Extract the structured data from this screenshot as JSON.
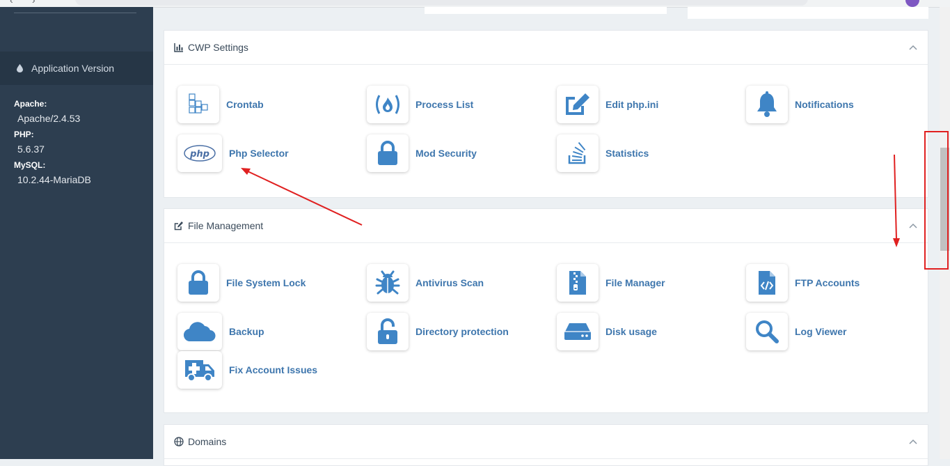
{
  "sidebar": {
    "app_version_label": "Application Version",
    "versions": [
      {
        "key": "Apache:",
        "value": "Apache/2.4.53"
      },
      {
        "key": "PHP:",
        "value": "5.6.37"
      },
      {
        "key": "MySQL:",
        "value": "10.2.44-MariaDB"
      }
    ]
  },
  "cwp_settings": {
    "title": "CWP Settings",
    "items": [
      {
        "label": "Crontab",
        "icon": "crontab-icon"
      },
      {
        "label": "Process List",
        "icon": "process-list-icon"
      },
      {
        "label": "Edit php.ini",
        "icon": "edit-icon"
      },
      {
        "label": "Notifications",
        "icon": "bell-icon"
      },
      {
        "label": "Php Selector",
        "icon": "php-icon"
      },
      {
        "label": "Mod Security",
        "icon": "lock-icon"
      },
      {
        "label": "Statistics",
        "icon": "stack-icon"
      }
    ]
  },
  "file_management": {
    "title": "File Management",
    "items": [
      {
        "label": "File System Lock",
        "icon": "lock-icon"
      },
      {
        "label": "Antivirus Scan",
        "icon": "bug-icon"
      },
      {
        "label": "File Manager",
        "icon": "file-archive-icon"
      },
      {
        "label": "FTP Accounts",
        "icon": "file-code-icon"
      },
      {
        "label": "Backup",
        "icon": "cloud-icon"
      },
      {
        "label": "Directory protection",
        "icon": "unlock-icon"
      },
      {
        "label": "Disk usage",
        "icon": "hdd-icon"
      },
      {
        "label": "Log Viewer",
        "icon": "search-icon"
      },
      {
        "label": "Fix Account Issues",
        "icon": "ambulance-icon"
      }
    ]
  },
  "domains": {
    "title": "Domains"
  },
  "colors": {
    "accent": "#3e76ad",
    "icon": "#3f85c6",
    "sidebar": "#2d3e50",
    "annotation": "#e02020"
  }
}
